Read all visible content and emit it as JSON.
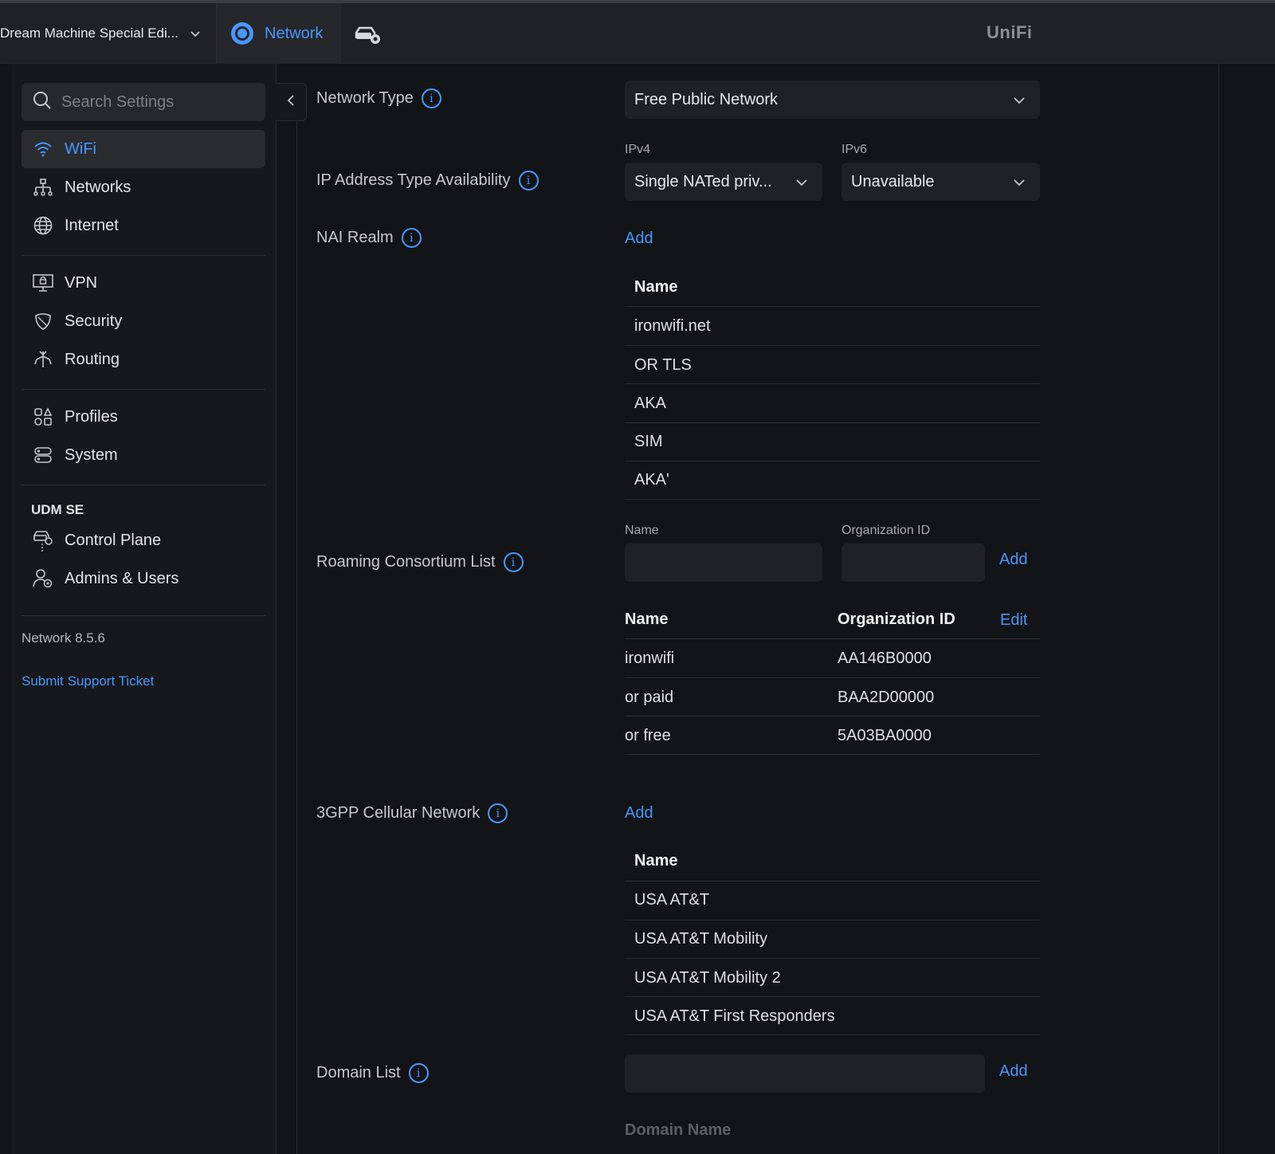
{
  "topbar": {
    "console_name": "Dream Machine Special Edi...",
    "app_tab": "Network",
    "brand": "UniFi"
  },
  "sidebar": {
    "search_placeholder": "Search Settings",
    "items": [
      {
        "label": "WiFi",
        "icon": "wifi-icon"
      },
      {
        "label": "Networks",
        "icon": "network-tree-icon"
      },
      {
        "label": "Internet",
        "icon": "globe-icon"
      },
      {
        "label": "VPN",
        "icon": "vpn-icon"
      },
      {
        "label": "Security",
        "icon": "shield-icon"
      },
      {
        "label": "Routing",
        "icon": "routing-icon"
      },
      {
        "label": "Profiles",
        "icon": "profiles-icon"
      },
      {
        "label": "System",
        "icon": "system-icon"
      }
    ],
    "section_label": "UDM SE",
    "udm_items": [
      {
        "label": "Control Plane",
        "icon": "control-plane-icon"
      },
      {
        "label": "Admins & Users",
        "icon": "admins-icon"
      }
    ],
    "version": "Network 8.5.6",
    "support_link": "Submit Support Ticket"
  },
  "form": {
    "network_type": {
      "label": "Network Type",
      "value": "Free Public Network"
    },
    "ip_availability": {
      "label": "IP Address Type Availability",
      "ipv4_label": "IPv4",
      "ipv4_value": "Single NATed priv...",
      "ipv6_label": "IPv6",
      "ipv6_value": "Unavailable"
    },
    "nai_realm": {
      "label": "NAI Realm",
      "add": "Add",
      "header": "Name",
      "rows": [
        "ironwifi.net",
        "OR TLS",
        "AKA",
        "SIM",
        "AKA'"
      ]
    },
    "roaming": {
      "label": "Roaming Consortium List",
      "name_label": "Name",
      "org_label": "Organization ID",
      "add": "Add",
      "col_name": "Name",
      "col_org": "Organization ID",
      "edit": "Edit",
      "rows": [
        {
          "name": "ironwifi",
          "org": "AA146B0000"
        },
        {
          "name": "or paid",
          "org": "BAA2D00000"
        },
        {
          "name": "or free",
          "org": "5A03BA0000"
        }
      ]
    },
    "cellular": {
      "label": "3GPP Cellular Network",
      "add": "Add",
      "header": "Name",
      "rows": [
        "USA AT&T",
        "USA AT&T Mobility",
        "USA AT&T Mobility 2",
        "USA AT&T First Responders"
      ]
    },
    "domain": {
      "label": "Domain List",
      "add": "Add",
      "header": "Domain Name"
    }
  }
}
